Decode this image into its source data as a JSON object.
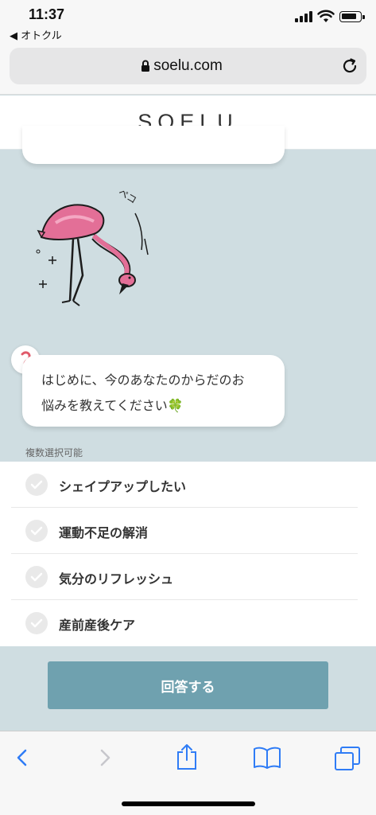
{
  "status_bar": {
    "time": "11:37",
    "back_app": "◀ オトクル"
  },
  "browser": {
    "url": "soelu.com"
  },
  "site": {
    "logo": "SOELU"
  },
  "chat": {
    "message_line1": "はじめに、今のあなたのからだのお",
    "message_line2": "悩みを教えてください",
    "message_emoji": "🍀",
    "multi_select_note": "複数選択可能"
  },
  "options": [
    {
      "label": "シェイプアップしたい",
      "checked": false
    },
    {
      "label": "運動不足の解消",
      "checked": false
    },
    {
      "label": "気分のリフレッシュ",
      "checked": false
    },
    {
      "label": "産前産後ケア",
      "checked": false
    }
  ],
  "submit": {
    "label": "回答する"
  },
  "colors": {
    "background": "#cfdde1",
    "button": "#6fa1af",
    "ios_blue": "#2f7cf6"
  },
  "toolbar_icons": [
    "back-icon",
    "forward-icon",
    "share-icon",
    "bookmarks-icon",
    "tabs-icon"
  ]
}
